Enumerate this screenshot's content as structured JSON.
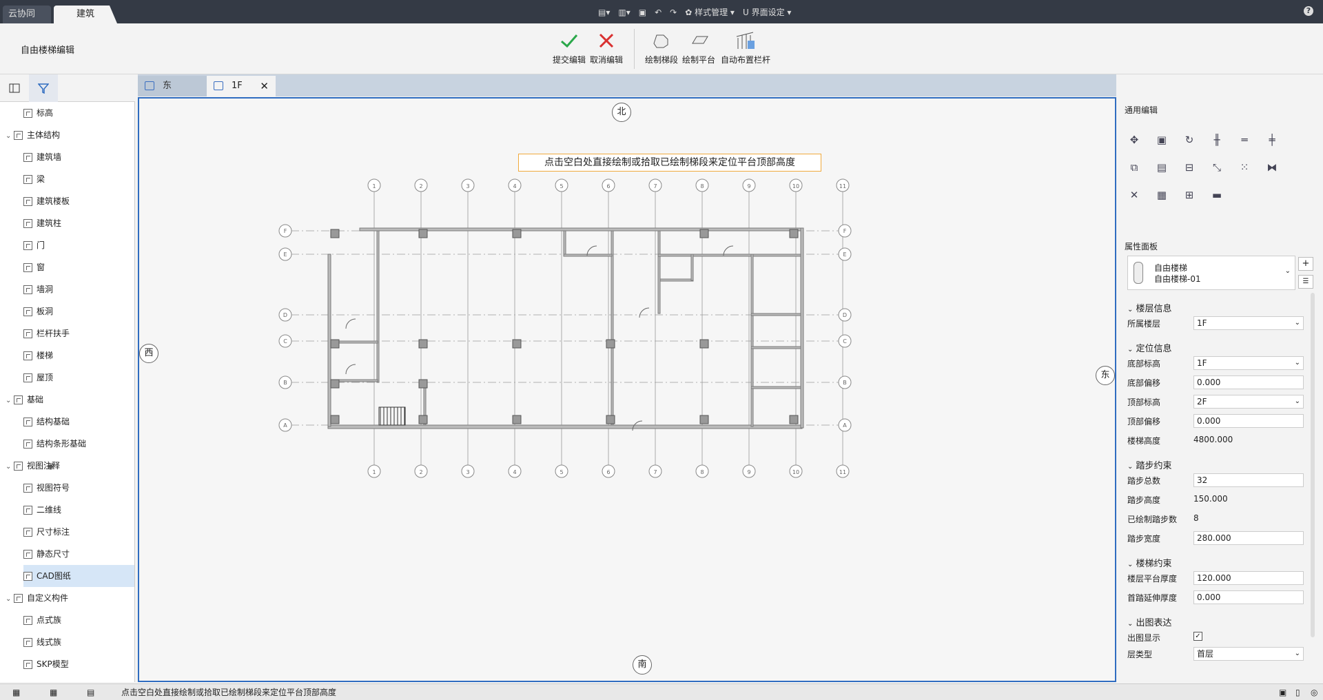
{
  "topbar": {
    "tab_cloud": "云协同",
    "tab_build": "建筑",
    "style_manage": "样式管理",
    "ui_settings": "界面设定"
  },
  "ribbon": {
    "title": "自由楼梯编辑",
    "submit": "提交编辑",
    "cancel": "取消编辑",
    "draw_flight": "绘制梯段",
    "draw_platform": "绘制平台",
    "auto_rail": "自动布置栏杆"
  },
  "tree": [
    {
      "label": "标高",
      "level": 1
    },
    {
      "label": "主体结构",
      "level": 0
    },
    {
      "label": "建筑墙",
      "level": 1
    },
    {
      "label": "梁",
      "level": 1
    },
    {
      "label": "建筑楼板",
      "level": 1
    },
    {
      "label": "建筑柱",
      "level": 1
    },
    {
      "label": "门",
      "level": 1
    },
    {
      "label": "窗",
      "level": 1
    },
    {
      "label": "墙洞",
      "level": 1
    },
    {
      "label": "板洞",
      "level": 1
    },
    {
      "label": "栏杆扶手",
      "level": 1
    },
    {
      "label": "楼梯",
      "level": 1
    },
    {
      "label": "屋顶",
      "level": 1
    },
    {
      "label": "基础",
      "level": 0
    },
    {
      "label": "结构基础",
      "level": 1
    },
    {
      "label": "结构条形基础",
      "level": 1
    },
    {
      "label": "视图注释",
      "level": 0
    },
    {
      "label": "视图符号",
      "level": 1
    },
    {
      "label": "二维线",
      "level": 1
    },
    {
      "label": "尺寸标注",
      "level": 1
    },
    {
      "label": "静态尺寸",
      "level": 1
    },
    {
      "label": "CAD图纸",
      "level": 1
    },
    {
      "label": "自定义构件",
      "level": 0
    },
    {
      "label": "点式族",
      "level": 1
    },
    {
      "label": "线式族",
      "level": 1
    },
    {
      "label": "SKP模型",
      "level": 1
    }
  ],
  "tabs": {
    "east": "东",
    "floor": "1F"
  },
  "canvas": {
    "hint": "点击空白处直接绘制或拾取已绘制梯段来定位平台顶部高度",
    "north": "北",
    "south": "南",
    "west": "西",
    "east": "东",
    "col_axes": [
      "1",
      "2",
      "3",
      "4",
      "5",
      "6",
      "7",
      "8",
      "9",
      "10",
      "11"
    ],
    "row_axes": [
      "F",
      "E",
      "D",
      "C",
      "B",
      "A"
    ]
  },
  "panel": {
    "general_edit": "通用编辑",
    "property_panel": "属性面板",
    "type_name": "自由楼梯",
    "type_sub": "自由楼梯-01",
    "groups": {
      "floor_info": "楼层信息",
      "position_info": "定位信息",
      "step_constraint": "踏步约束",
      "stair_constraint": "楼梯约束",
      "drawing": "出图表达"
    },
    "labels": {
      "floor": "所属楼层",
      "base_level": "底部标高",
      "base_offset": "底部偏移",
      "top_level": "顶部标高",
      "top_offset": "顶部偏移",
      "stair_height": "楼梯高度",
      "step_total": "踏步总数",
      "step_height": "踏步高度",
      "steps_drawn": "已绘制踏步数",
      "step_width": "踏步宽度",
      "landing_thick": "楼层平台厚度",
      "first_ext": "首踏延伸厚度",
      "show_drawing": "出图显示",
      "layer_type": "层类型"
    },
    "values": {
      "floor": "1F",
      "base_level": "1F",
      "base_offset": "0.000",
      "top_level": "2F",
      "top_offset": "0.000",
      "stair_height": "4800.000",
      "step_total": "32",
      "step_height": "150.000",
      "steps_drawn": "8",
      "step_width": "280.000",
      "landing_thick": "120.000",
      "first_ext": "0.000",
      "layer_type": "首层"
    }
  },
  "status": {
    "text": "点击空白处直接绘制或拾取已绘制梯段来定位平台顶部高度"
  }
}
